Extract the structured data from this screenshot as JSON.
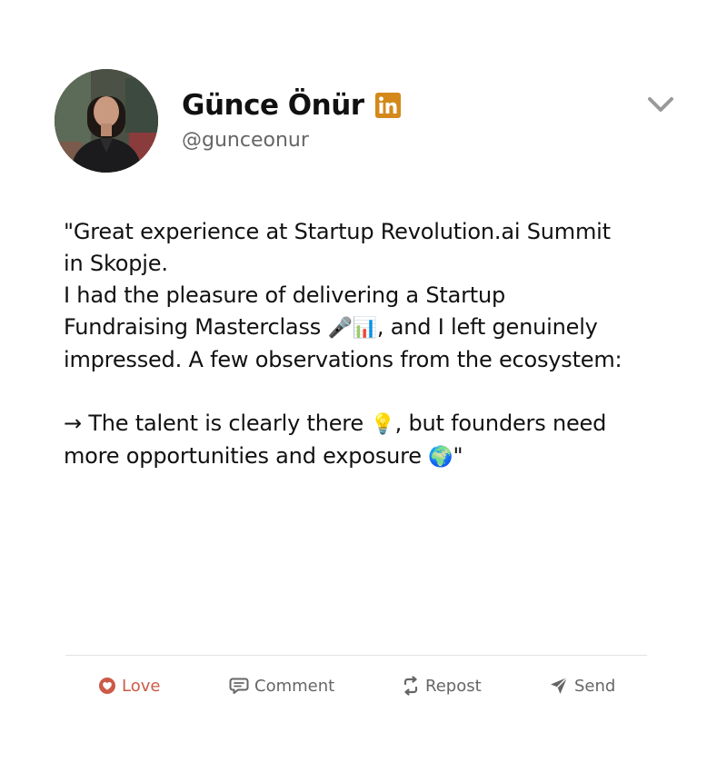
{
  "author": {
    "name": "Günce Önür",
    "handle": "@gunceonur",
    "platform_icon": "linkedin-icon"
  },
  "post": {
    "lines": [
      "\"Great experience at Startup Revolution.ai Summit in Skopje.",
      "I had the pleasure of delivering a Startup Fundraising Masterclass ",
      "🎤📊",
      ", and I left genuinely impressed. A few observations from the ecosystem:",
      "→ The talent is clearly there ",
      "💡",
      ", but founders need more opportunities and exposure ",
      "🌍",
      "\""
    ]
  },
  "actions": {
    "love": "Love",
    "comment": "Comment",
    "repost": "Repost",
    "send": "Send"
  },
  "colors": {
    "linkedin_accent": "#d4891a",
    "love_accent": "#cc5a47",
    "muted_text": "#666666",
    "divider": "#e3e3e3"
  }
}
